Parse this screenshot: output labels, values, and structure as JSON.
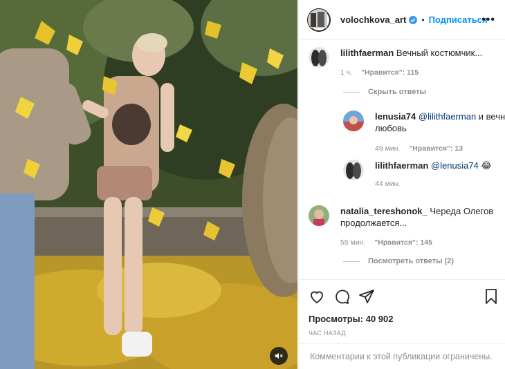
{
  "post": {
    "author": "volochkova_art",
    "verified": true,
    "follow_label": "Подписаться",
    "separator": "•",
    "more_label": "•••"
  },
  "comments": [
    {
      "user": "lilithfaerman",
      "text": "Вечный костюмчик...",
      "time": "1 ч.",
      "likes": "\"Нравится\": 115",
      "replies_toggle": "Скрыть ответы"
    },
    {
      "user": "lenusia74",
      "mention": "@lilithfaerman",
      "text": " и вечная",
      "text2": "любовь",
      "time": "49 мин.",
      "likes": "\"Нравится\": 13"
    },
    {
      "user": "lilithfaerman",
      "mention": "@lenusia74",
      "emoji": "😂",
      "time": "44 мин."
    },
    {
      "user": "natalia_tereshonok_",
      "text": " Череда Олегов",
      "text2": "продолжается...",
      "time": "55 мин.",
      "likes": "\"Нравится\": 145",
      "replies_toggle": "Посмотреть ответы (2)"
    }
  ],
  "footer": {
    "views_label": "Просмотры:",
    "views_value": "40 902",
    "time": "час назад",
    "comments_limited": "Комментарии к этой публикации ограничены."
  },
  "icons": [
    "heart-icon",
    "comment-icon",
    "share-icon",
    "bookmark-icon",
    "mute-icon",
    "verified-icon"
  ],
  "colors": {
    "accent": "#0095f6",
    "verified": "#3897f0",
    "muted_text": "#8e8e8e",
    "mention": "#00376b"
  }
}
